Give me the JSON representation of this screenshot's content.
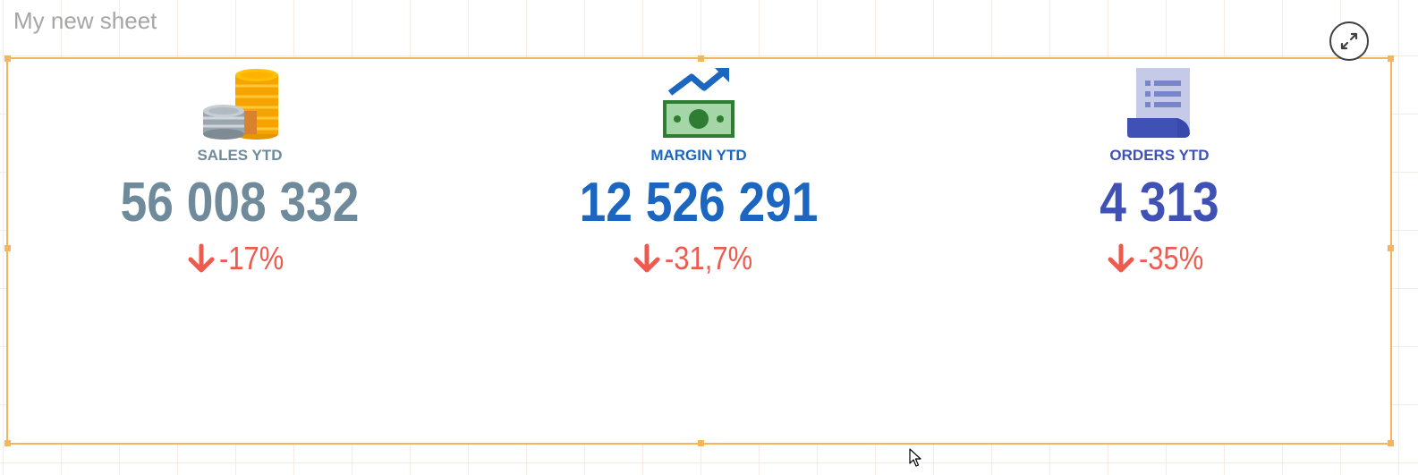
{
  "sheet": {
    "title": "My new sheet"
  },
  "colors": {
    "frame_border": "#f5b55e",
    "sales": "#6f8a9b",
    "margin": "#1a66c0",
    "orders": "#3f51b5",
    "negative": "#ef5a4e"
  },
  "kpis": [
    {
      "label": "SALES YTD",
      "value": "56 008 332",
      "change": "-17%",
      "icon": "coins-icon",
      "change_icon": "arrow-down-icon"
    },
    {
      "label": "MARGIN YTD",
      "value": "12 526 291",
      "change": "-31,7%",
      "icon": "money-trend-up-icon",
      "change_icon": "arrow-down-icon"
    },
    {
      "label": "ORDERS YTD",
      "value": "4 313",
      "change": "-35%",
      "icon": "receipt-list-icon",
      "change_icon": "arrow-down-icon"
    }
  ],
  "toolbar": {
    "expand_icon": "expand-icon"
  }
}
